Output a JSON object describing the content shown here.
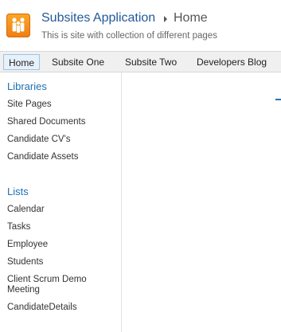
{
  "header": {
    "site_title": "Subsites Application",
    "current_page": "Home",
    "description": "This is site with collection of different pages"
  },
  "top_nav": {
    "tabs": [
      {
        "label": "Home",
        "active": true
      },
      {
        "label": "Subsite One",
        "active": false
      },
      {
        "label": "Subsite Two",
        "active": false
      },
      {
        "label": "Developers Blog",
        "active": false
      }
    ]
  },
  "quick_launch": {
    "libraries": {
      "heading": "Libraries",
      "items": [
        "Site Pages",
        "Shared Documents",
        "Candidate CV's",
        "Candidate Assets"
      ]
    },
    "lists": {
      "heading": "Lists",
      "items": [
        "Calendar",
        "Tasks",
        "Employee",
        "Students",
        "Client Scrum Demo Meeting",
        "CandidateDetails"
      ]
    }
  },
  "colors": {
    "link_blue": "#1f6fb2",
    "title_blue": "#23599a",
    "logo_orange": "#f39a1f"
  }
}
